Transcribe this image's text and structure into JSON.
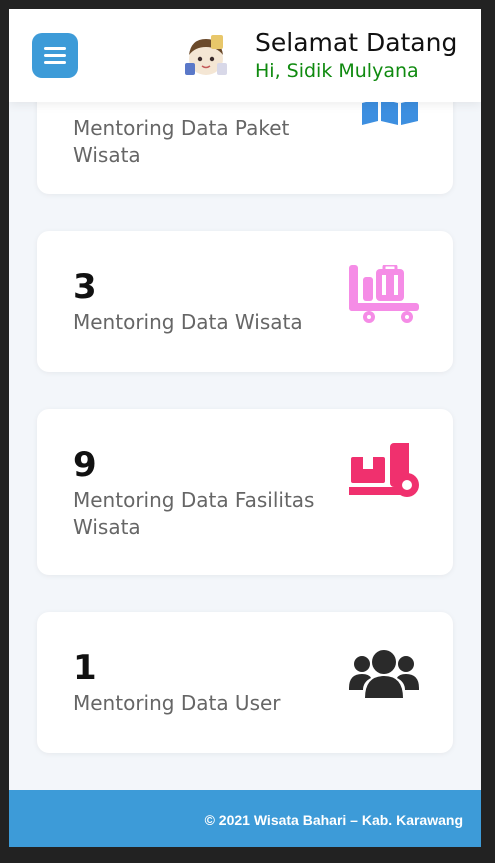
{
  "header": {
    "title": "Selamat Datang",
    "subtitle": "Hi, Sidik Mulyana"
  },
  "cards": [
    {
      "count": "",
      "label": "Mentoring Data Paket Wisata",
      "icon": "map-icon",
      "color": "#3d8fe0"
    },
    {
      "count": "3",
      "label": "Mentoring Data Wisata",
      "icon": "luggage-cart-icon",
      "color": "#f58ce6"
    },
    {
      "count": "9",
      "label": "Mentoring Data Fasilitas Wisata",
      "icon": "dolly-icon",
      "color": "#f0306e"
    },
    {
      "count": "1",
      "label": "Mentoring Data User",
      "icon": "users-icon",
      "color": "#2a2a2a"
    }
  ],
  "footer": {
    "text": "© 2021 Wisata Bahari – Kab. Karawang"
  },
  "colors": {
    "accent": "#3d9bd8",
    "greeting": "#0f8a0f"
  }
}
